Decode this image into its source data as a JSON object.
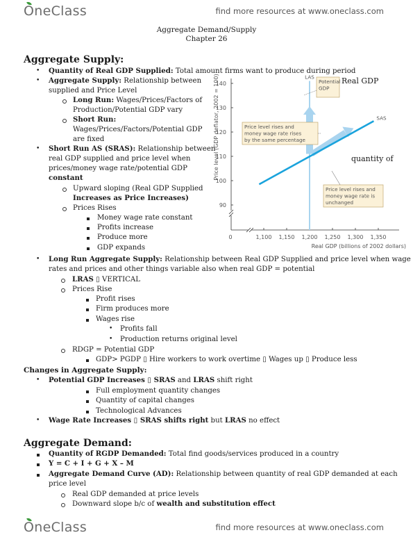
{
  "header": {
    "logo": "OneClass",
    "link": "find more resources at www.oneclass.com"
  },
  "footer": {
    "logo": "OneClass",
    "link": "find more resources at www.oneclass.com"
  },
  "title": {
    "line1": "Aggregate Demand/Supply",
    "line2": "Chapter 26"
  },
  "aggregate_supply": {
    "heading": "Aggregate Supply:",
    "items": [
      {
        "bold": "Quantity of Real GDP Supplied:",
        "text": " Total amount firms want to produce during period"
      },
      {
        "bold": "Aggregate Supply:",
        "text": " Relationship between",
        "cont": "supplied and Price Level"
      },
      {
        "bold": "Long Run:",
        "text": " Wages/Prices/Factors of",
        "cont": "Production/Potential GDP vary"
      },
      {
        "bold": "Short Run:",
        "cont1": "Wages/Prices/Factors/Potential GDP",
        "cont2": "are fixed"
      },
      {
        "bold": "Short Run AS (SRAS):",
        "text": " Relationship between",
        "cont1": "real GDP supplied and price level when",
        "cont2": "prices/money wage rate/potential GDP",
        "cont3": "constant"
      },
      {
        "text": "Upward sloping (Real GDP Supplied",
        "cont": "Increases as Price Increases)"
      },
      {
        "text": "Prices Rises"
      },
      {
        "text": "Money wage rate constant"
      },
      {
        "text": "Profits increase"
      },
      {
        "text": "Produce more"
      },
      {
        "text": "GDP expands"
      }
    ],
    "lras": {
      "bold": "Long Run Aggregate Supply:",
      "text": " Relationship between Real GDP Supplied and price level when wage",
      "cont": "rates and prices and other things variable also when real GDP = potential",
      "sub": [
        {
          "bold": "LRAS",
          "text": " ▯ VERTICAL"
        },
        {
          "text": "Prices Rise"
        },
        {
          "text": "Profit rises"
        },
        {
          "text": "Firm produces more"
        },
        {
          "text": "Wages rise"
        },
        {
          "text": "Profits fall"
        },
        {
          "text": "Production returns original level"
        },
        {
          "text": "RDGP = Potential GDP"
        },
        {
          "text": "GDP> PGDP ▯ Hire workers to work overtime ▯ Wages up ▯ Produce less"
        }
      ]
    }
  },
  "changes": {
    "heading": "Changes in Aggregate Supply:",
    "item1_bold": "Potential GDP Increases ▯ SRAS",
    "item1_mid": " and ",
    "item1_bold2": "LRAS",
    "item1_end": " shift right",
    "sub": [
      "Full employment quantity changes",
      "Quantity of capital changes",
      "Technological Advances"
    ],
    "item2_bold": "Wage Rate Increases ▯ SRAS shifts right",
    "item2_mid": " but ",
    "item2_bold2": "LRAS",
    "item2_end": " no effect"
  },
  "aggregate_demand": {
    "heading": "Aggregate Demand:",
    "item1_bold": "Quantity of RGDP Demanded:",
    "item1_text": " Total find goods/services produced in a country",
    "item2": "Y = C + I + G + X – M",
    "item3_bold": "Aggregate Demand Curve (AD):",
    "item3_text": " Relationship between quantity of real GDP demanded at each",
    "item3_cont": "price level",
    "sub1": "Real GDP demanded at price levels",
    "sub2_text": "Downward slope b/c of ",
    "sub2_bold": "wealth and substitution effect"
  },
  "overlay_text": {
    "real_gdp": "Real GDP",
    "quantity_of": "quantity of"
  },
  "chart_data": {
    "type": "line",
    "title": "",
    "xlabel": "Real GDP (billions of 2002 dollars)",
    "ylabel": "Price level (GDP deflator, 2002 = 100)",
    "xlim": [
      1050,
      1390
    ],
    "ylim": [
      85,
      143
    ],
    "x_ticks": [
      "0",
      "1,100",
      "1,150",
      "1,200",
      "1,250",
      "1,300",
      "1,350"
    ],
    "x_tick_values": [
      1100,
      1150,
      1200,
      1250,
      1300,
      1350
    ],
    "y_ticks": [
      90,
      100,
      110,
      120,
      130,
      140
    ],
    "series": [
      {
        "name": "SAS",
        "x": [
          1090,
          1340
        ],
        "y": [
          98.5,
          124.5
        ],
        "color": "#1aa3dc"
      },
      {
        "name": "LAS",
        "x": [
          1200,
          1200
        ],
        "y": [
          85,
          141
        ],
        "color": "#a9d4ef"
      }
    ],
    "arrows": [
      {
        "name": "vertical-arrow",
        "from": [
          1200,
          111
        ],
        "to": [
          1200,
          130
        ],
        "color": "#a9d4ef"
      },
      {
        "name": "along-sas-arrow",
        "from": [
          1205,
          111
        ],
        "to": [
          1290,
          121
        ],
        "color": "#a9d4ef"
      }
    ],
    "annotations": [
      {
        "label": "LAS",
        "text": "LAS"
      },
      {
        "label": "SAS",
        "text": "SAS"
      },
      {
        "label": "potential",
        "lines": [
          "Potential",
          "GDP"
        ]
      },
      {
        "label": "both-rise",
        "lines": [
          "Price level rises and",
          "money wage rate rises",
          "by the same percentage"
        ]
      },
      {
        "label": "wage-unchanged",
        "lines": [
          "Price level rises and",
          "money wage rate is",
          "unchanged"
        ]
      }
    ]
  }
}
